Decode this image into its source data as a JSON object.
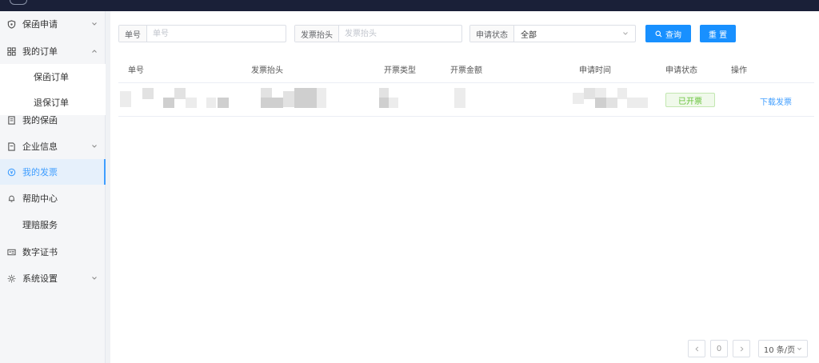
{
  "colors": {
    "accent": "#1890ff",
    "topbar": "#1a2038",
    "link": "#409eff",
    "status_success": "#67c23a"
  },
  "sidebar": {
    "items": [
      {
        "label": "保函申请",
        "icon": "shield-icon",
        "expandable": true,
        "expanded": false
      },
      {
        "label": "我的订单",
        "icon": "grid-icon",
        "expandable": true,
        "expanded": true
      },
      {
        "label": "保函订单",
        "sub": true
      },
      {
        "label": "退保订单",
        "sub": true
      },
      {
        "label": "我的保函",
        "icon": "document-icon"
      },
      {
        "label": "企业信息",
        "icon": "file-icon",
        "expandable": true,
        "expanded": false
      },
      {
        "label": "我的发票",
        "icon": "invoice-icon",
        "active": true
      },
      {
        "label": "帮助中心",
        "icon": "bell-icon"
      },
      {
        "label": "理赔服务"
      },
      {
        "label": "数字证书",
        "icon": "id-card-icon"
      },
      {
        "label": "系统设置",
        "icon": "gear-icon",
        "expandable": true,
        "expanded": false
      }
    ]
  },
  "filters": {
    "order_no": {
      "label": "单号",
      "placeholder": "单号",
      "value": ""
    },
    "invoice_title": {
      "label": "发票抬头",
      "placeholder": "发票抬头",
      "value": ""
    },
    "status": {
      "label": "申请状态",
      "value": "全部"
    }
  },
  "buttons": {
    "search": "查询",
    "reset": "重 置"
  },
  "table": {
    "columns": [
      "单号",
      "发票抬头",
      "开票类型",
      "开票金额",
      "申请时间",
      "申请状态",
      "操作"
    ],
    "rows": [
      {
        "status": "已开票",
        "action": "下载发票"
      }
    ]
  },
  "pagination": {
    "current_page": "0",
    "page_size": "10 条/页"
  }
}
